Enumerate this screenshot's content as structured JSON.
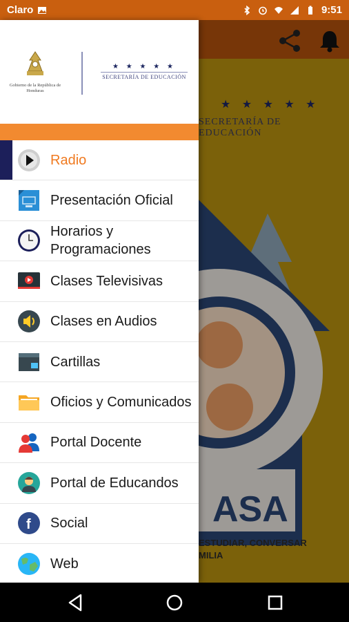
{
  "status_bar": {
    "carrier": "Claro",
    "time": "9:51"
  },
  "header": {
    "gov_logo_text": "Gobierno de la República de Honduras",
    "secretaria_text": "SECRETARÍA DE EDUCACIÓN",
    "stars": "★ ★ ★ ★ ★"
  },
  "menu": {
    "items": [
      {
        "label": "Radio",
        "icon": "radio-icon",
        "active": true
      },
      {
        "label": "Presentación Oficial",
        "icon": "presentation-icon",
        "active": false
      },
      {
        "label": "Horarios y Programaciones",
        "icon": "clock-icon",
        "active": false
      },
      {
        "label": "Clases Televisivas",
        "icon": "tv-icon",
        "active": false
      },
      {
        "label": "Clases en Audios",
        "icon": "speaker-icon",
        "active": false
      },
      {
        "label": "Cartillas",
        "icon": "booklet-icon",
        "active": false
      },
      {
        "label": "Oficios y Comunicados",
        "icon": "folder-icon",
        "active": false
      },
      {
        "label": "Portal Docente",
        "icon": "teachers-icon",
        "active": false
      },
      {
        "label": "Portal de Educandos",
        "icon": "student-icon",
        "active": false
      },
      {
        "label": "Social",
        "icon": "facebook-icon",
        "active": false
      },
      {
        "label": "Web",
        "icon": "globe-icon",
        "active": false
      }
    ]
  },
  "background_app": {
    "secretaria_text": "SECRETARÍA DE EDUCACIÓN",
    "stars": "★ ★ ★ ★ ★",
    "caption": "ESTUDIAR, CONVERSAR\nMILIA"
  },
  "colors": {
    "status_bar": "#c95f0f",
    "accent_orange": "#f28a30",
    "active_text": "#f07a20",
    "active_marker": "#1c1f5a"
  }
}
